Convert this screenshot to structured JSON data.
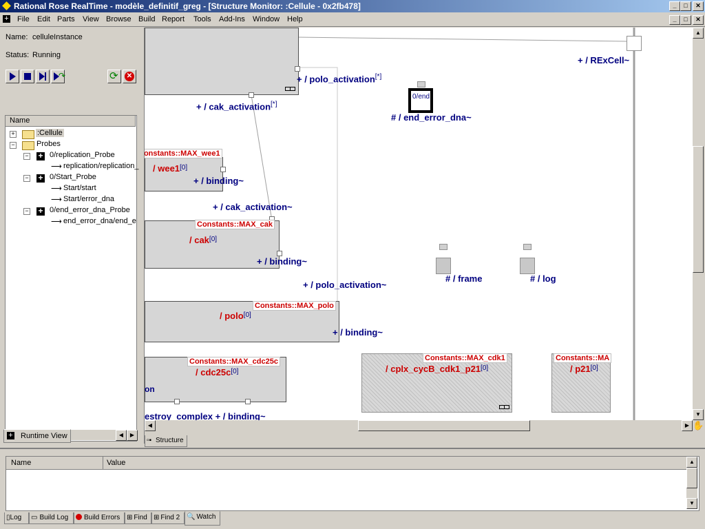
{
  "window": {
    "title": "Rational Rose RealTime - modèle_definitif_greg - [Structure Monitor: :Cellule - 0x2fb478]"
  },
  "menu": [
    "File",
    "Edit",
    "Parts",
    "View",
    "Browse",
    "Build",
    "Report",
    "Tools",
    "Add-Ins",
    "Window",
    "Help"
  ],
  "runtime": {
    "name_label": "Name:",
    "name_value": "celluleInstance",
    "status_label": "Status:",
    "status_value": "Running"
  },
  "tree": {
    "header": "Name",
    "items": [
      ":Cellule",
      "Probes",
      "0/replication_Probe",
      "replication/replication_",
      "0/Start_Probe",
      "Start/start",
      "Start/error_dna",
      "0/end_error_dna_Probe",
      "end_error_dna/end_e"
    ]
  },
  "left_tab": "Runtime View",
  "diagram": {
    "rexcell": "+ / RExCell~",
    "polo_activation_top": "+ / polo_activation",
    "cak_activation_top": "+ / cak_activation",
    "end_error_dna": "# / end_error_dna~",
    "end_box": "0/end",
    "wee1_const": "Constants::MAX_wee1",
    "wee1_name": "/ wee1",
    "binding1": "+ / binding~",
    "cak_activation2": "+ / cak_activation~",
    "cak_const": "Constants::MAX_cak",
    "cak_name": "/ cak",
    "binding2": "+ / binding~",
    "frame": "# / frame",
    "log": "# / log",
    "polo_activation2": "+ / polo_activation~",
    "polo_const": "Constants::MAX_polo",
    "polo_name": "/ polo",
    "binding3": "+ / binding~",
    "cdc25c_const": "Constants::MAX_cdc25c",
    "cdc25c_name": "/ cdc25c",
    "cdc25c_frag": "on",
    "cdk1_const": "Constants::MAX_cdk1",
    "cdk1_name": "/ cplx_cycB_cdk1_p21",
    "p21_const": "Constants::MA",
    "p21_name": "/ p21",
    "bottom_text": "estroy_complex + / binding~",
    "idx": "[0]",
    "mult": "[*]"
  },
  "structure_tab": "Structure",
  "watch": {
    "col_name": "Name",
    "col_value": "Value"
  },
  "bottom_tabs": [
    "Log",
    "Build Log",
    "Build Errors",
    "Find",
    "Find 2",
    "Watch"
  ]
}
